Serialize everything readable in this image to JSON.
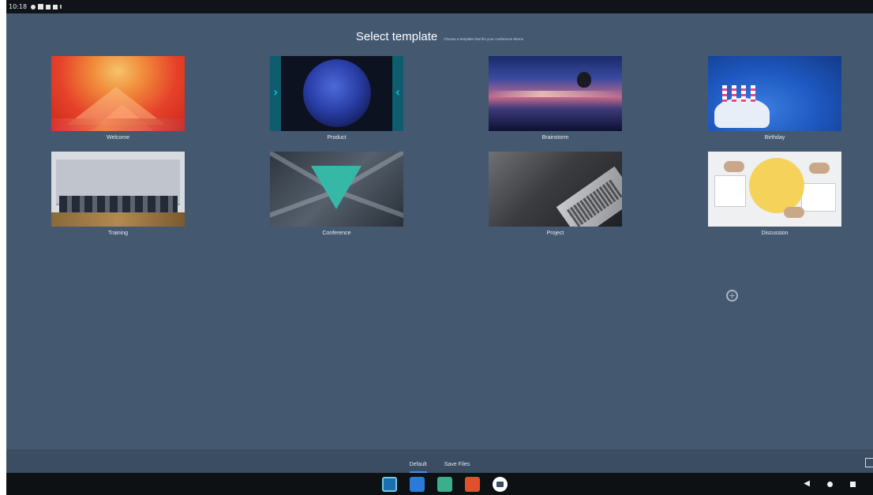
{
  "status_bar": {
    "time": "10:18",
    "icons": [
      "settings-icon",
      "square-icon",
      "sim-icon",
      "battery-icon",
      "dot-icon"
    ]
  },
  "header": {
    "title": "Select template",
    "subtitle": "Choose a template that fits your conference theme"
  },
  "templates": [
    {
      "label": "Welcome",
      "thumbnail": "welcome-thumbnail"
    },
    {
      "label": "Product",
      "thumbnail": "product-thumbnail"
    },
    {
      "label": "Brainstorm",
      "thumbnail": "brainstorm-thumbnail"
    },
    {
      "label": "Birthday",
      "thumbnail": "birthday-thumbnail"
    },
    {
      "label": "Training",
      "thumbnail": "training-thumbnail"
    },
    {
      "label": "Conference",
      "thumbnail": "conference-thumbnail"
    },
    {
      "label": "Project",
      "thumbnail": "project-thumbnail"
    },
    {
      "label": "Discussion",
      "thumbnail": "discussion-thumbnail"
    }
  ],
  "add_button": {
    "icon": "plus-icon"
  },
  "tab_bar": {
    "tabs": [
      {
        "label": "Default",
        "active": true
      },
      {
        "label": "Save Files",
        "active": false
      }
    ],
    "exit_icon": "exit-icon"
  },
  "dock": {
    "apps": [
      "whiteboard-app-icon",
      "gallery-app-icon",
      "settings-app-icon",
      "office-app-icon",
      "keyboard-app-icon"
    ]
  },
  "nav": {
    "back": "◀",
    "home_icon": "home-icon",
    "recents_icon": "recents-icon"
  },
  "colors": {
    "background": "#445870",
    "tab_bar": "#3a4d62",
    "active_tab": "#4a8ee0",
    "nav_bar": "#0e1114"
  }
}
